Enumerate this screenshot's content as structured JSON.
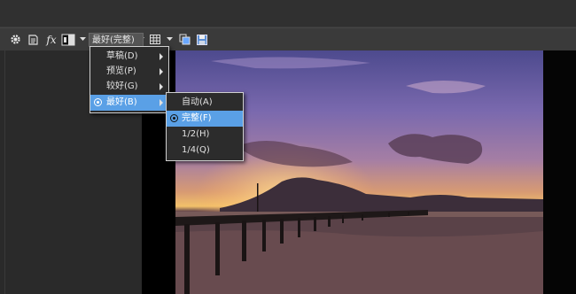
{
  "toolbar": {
    "icons": [
      "gear-icon",
      "stamp-icon",
      "fx-icon",
      "compare-icon",
      "dropdown-caret-icon",
      "grid-icon",
      "copy-icon",
      "save-icon"
    ],
    "fx_label": "fx",
    "quality_value": "最好(完整)"
  },
  "menu_quality": {
    "items": [
      {
        "label": "草稿(D)",
        "has_submenu": true
      },
      {
        "label": "预览(P)",
        "has_submenu": true
      },
      {
        "label": "较好(G)",
        "has_submenu": true
      },
      {
        "label": "最好(B)",
        "has_submenu": true,
        "selected": true,
        "checked": true
      }
    ]
  },
  "menu_resolution": {
    "items": [
      {
        "label": "自动(A)"
      },
      {
        "label": "完整(F)",
        "selected": true,
        "checked": true
      },
      {
        "label": "1/2(H)"
      },
      {
        "label": "1/4(Q)"
      }
    ]
  },
  "colors": {
    "highlight": "#5aa0e6",
    "menu_bg": "#2c2c2c",
    "toolbar_bg": "#3a3a3a",
    "panel_bg": "#2a2a2a"
  }
}
